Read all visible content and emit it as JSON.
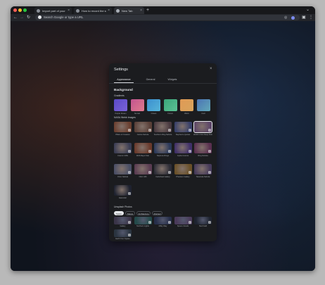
{
  "browser": {
    "tabs": [
      {
        "title": "Import part of your screensh...",
        "active": false
      },
      {
        "title": "How to record the screen on...",
        "active": false
      },
      {
        "title": "New Tab",
        "active": true
      }
    ],
    "new_tab_symbol": "+",
    "omnibox_placeholder": "Search Google or type a URL"
  },
  "icons": {
    "back": "←",
    "forward": "→",
    "reload": "↻",
    "tab_close": "×",
    "tab_list": "⌄",
    "lens": "◎",
    "extensions": "▣",
    "menu": "⋮",
    "close": "×"
  },
  "settings": {
    "title": "Settings",
    "tabs": [
      {
        "label": "Appearance",
        "active": true
      },
      {
        "label": "General",
        "active": false
      },
      {
        "label": "Widgets",
        "active": false
      }
    ],
    "background_heading": "Background",
    "gradients": {
      "heading": "Gradients",
      "items": [
        {
          "label": "Purple Dream",
          "colors": [
            "#5a4ac8",
            "#7b63d6"
          ]
        },
        {
          "label": "Sunset",
          "colors": [
            "#c2558f",
            "#e07a8e"
          ]
        },
        {
          "label": "Ocean",
          "colors": [
            "#3b8fd0",
            "#57b5d8"
          ]
        },
        {
          "label": "Forest",
          "colors": [
            "#3aa57a",
            "#5cc295"
          ]
        },
        {
          "label": "Warm",
          "colors": [
            "#e09a55",
            "#d8a35c"
          ]
        },
        {
          "label": "Cool",
          "colors": [
            "#4b74b5",
            "#62a9b8"
          ]
        }
      ]
    },
    "nasa": {
      "heading": "NASA Webb Images",
      "items": [
        {
          "label": "Pillars of Creation",
          "color": "#6b4030",
          "selected": false
        },
        {
          "label": "Carina Nebula",
          "color": "#5a4038",
          "selected": false
        },
        {
          "label": "Southern Ring Nebula",
          "color": "#4a3a40",
          "selected": false
        },
        {
          "label": "Stephan's Quintet",
          "color": "#38406a",
          "selected": false
        },
        {
          "label": "Webb's First Deep Field",
          "color": "#5d4668",
          "selected": true
        },
        {
          "label": "Cosmic Cliffs",
          "color": "#3b3e55",
          "selected": false
        },
        {
          "label": "Wolf-Rayet Star",
          "color": "#6a3a2c",
          "selected": false
        },
        {
          "label": "Neptune Rings",
          "color": "#2c3a5c",
          "selected": false
        },
        {
          "label": "Jupiter Aurora",
          "color": "#40306a",
          "selected": false
        },
        {
          "label": "Ring Nebula",
          "color": "#5a3050",
          "selected": false
        },
        {
          "label": "Orion Nebula",
          "color": "#4a4f66",
          "selected": false
        },
        {
          "label": "NGC 346",
          "color": "#5a3c52",
          "selected": false
        },
        {
          "label": "Cartwheel Galaxy",
          "color": "#2e2e38",
          "selected": false
        },
        {
          "label": "Phantom Galaxy",
          "color": "#6a5028",
          "selected": false
        },
        {
          "label": "Tarantula Nebula",
          "color": "#463a5a",
          "selected": false
        },
        {
          "label": "Earendel",
          "color": "#1e2230",
          "selected": false
        }
      ]
    },
    "unsplash": {
      "heading": "Unsplash Photos",
      "chips": [
        {
          "label": "Space",
          "active": true
        },
        {
          "label": "Nature",
          "active": false
        },
        {
          "label": "Architecture",
          "active": false
        },
        {
          "label": "Abstract",
          "active": false
        }
      ],
      "items": [
        {
          "label": "Galaxy",
          "color": "#3a3448"
        },
        {
          "label": "Northern Lights",
          "color": "#244a4a"
        },
        {
          "label": "Milky Way",
          "color": "#262e4a"
        },
        {
          "label": "Space Clouds",
          "color": "#4a3a5a"
        },
        {
          "label": "Star Field",
          "color": "#1e2330"
        },
        {
          "label": "Earth from Space",
          "color": "#2a3440"
        }
      ]
    }
  }
}
